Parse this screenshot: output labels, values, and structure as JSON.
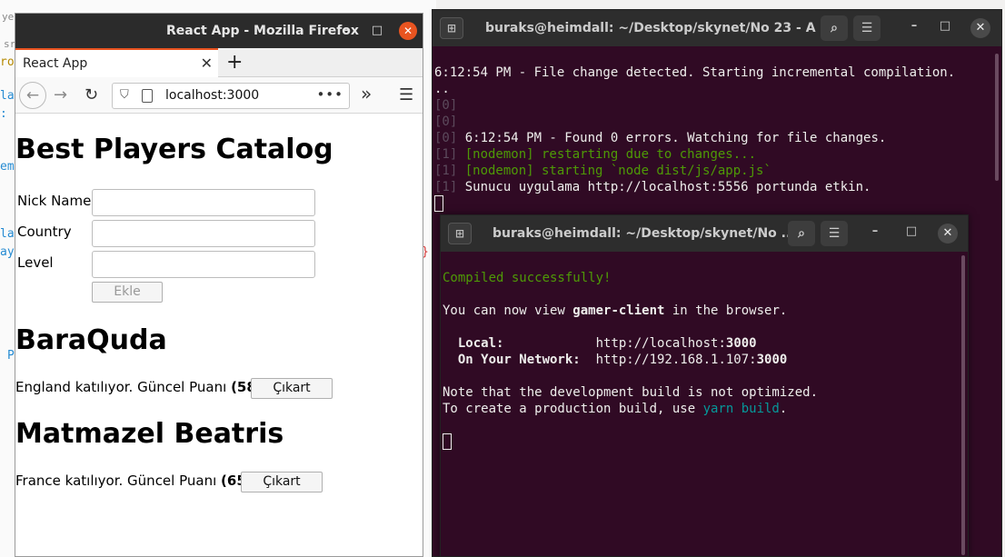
{
  "background_edges": [
    "yer",
    "sr",
    "ro",
    "la",
    ":",
    "em",
    "la",
    "ay",
    "P",
    "}"
  ],
  "firefox": {
    "window_title": "React App - Mozilla Firefox",
    "controls": {
      "minimize": "–",
      "maximize": "□",
      "close": "✕"
    },
    "tab": {
      "label": "React App",
      "close": "✕"
    },
    "new_tab": "+",
    "nav": {
      "back": "←",
      "forward": "→",
      "reload": "↻",
      "url": "localhost:3000",
      "more": "•••",
      "overflow": "»",
      "menu": "☰"
    },
    "page": {
      "title": "Best Players Catalog",
      "form": {
        "nick_label": "Nick Name",
        "country_label": "Country",
        "level_label": "Level",
        "submit": "Ekle"
      },
      "players": [
        {
          "name": "BaraQuda",
          "country": "England",
          "text": "katılıyor. Güncel Puanı",
          "score": "(58)",
          "button": "Çıkart"
        },
        {
          "name": "Matmazel Beatris",
          "country": "France",
          "text": "katılıyor. Güncel Puanı",
          "score": "(65)",
          "button": "Çıkart"
        }
      ]
    }
  },
  "terminal_back": {
    "title": "buraks@heimdall: ~/Desktop/skynet/No 23 - A ...",
    "lines": {
      "l1": "6:12:54 PM - File change detected. Starting incremental compilation.",
      "l2": "..",
      "l3": "[0]",
      "l4": "[0]",
      "l5_prefix": "[0] ",
      "l5": "6:12:54 PM - Found 0 errors. Watching for file changes.",
      "l6_prefix": "[1] ",
      "l6": "[nodemon] restarting due to changes...",
      "l7_prefix": "[1] ",
      "l7": "[nodemon] starting `node dist/js/app.js`",
      "l8_prefix": "[1] ",
      "l8": "Sunucu uygulama http://localhost:5556 portunda etkin."
    }
  },
  "terminal_front": {
    "title": "buraks@heimdall: ~/Desktop/skynet/No ...",
    "compiled": "Compiled successfully!",
    "view_prefix": "You can now view ",
    "app_name": "gamer-client",
    "view_suffix": " in the browser.",
    "local_label": "Local:",
    "local_url": "http://localhost:",
    "local_port": "3000",
    "network_label": "On Your Network:",
    "network_url": "http://192.168.1.107:",
    "network_port": "3000",
    "note1": "Note that the development build is not optimized.",
    "note2_prefix": "To create a production build, use ",
    "note2_cmd": "yarn build",
    "note2_suffix": "."
  }
}
